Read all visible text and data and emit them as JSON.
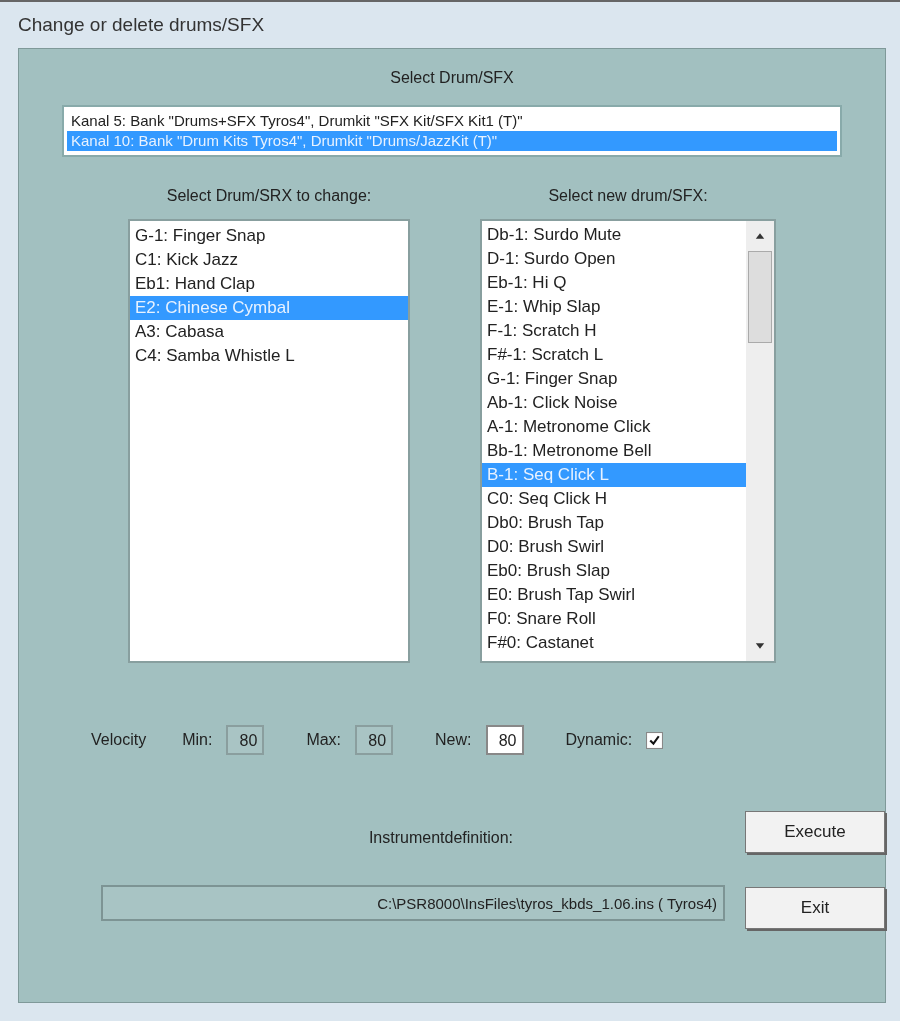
{
  "window": {
    "title": "Change or delete drums/SFX"
  },
  "kit_section": {
    "label": "Select Drum/SFX",
    "items": [
      {
        "text": "Kanal 5: Bank \"Drums+SFX Tyros4\", Drumkit \"SFX Kit/SFX Kit1 (T)\"",
        "selected": false
      },
      {
        "text": "Kanal 10: Bank \"Drum Kits Tyros4\", Drumkit \"Drums/JazzKit (T)\"",
        "selected": true
      }
    ]
  },
  "change_list": {
    "label": "Select Drum/SRX to change:",
    "items": [
      {
        "text": "G-1: Finger Snap",
        "selected": false
      },
      {
        "text": "C1: Kick Jazz",
        "selected": false
      },
      {
        "text": "Eb1: Hand Clap",
        "selected": false
      },
      {
        "text": "E2: Chinese Cymbal",
        "selected": true
      },
      {
        "text": "A3: Cabasa",
        "selected": false
      },
      {
        "text": "C4: Samba Whistle L",
        "selected": false
      }
    ]
  },
  "new_list": {
    "label": "Select new drum/SFX:",
    "items": [
      {
        "text": "Db-1: Surdo Mute",
        "selected": false
      },
      {
        "text": "D-1: Surdo Open",
        "selected": false
      },
      {
        "text": "Eb-1: Hi Q",
        "selected": false
      },
      {
        "text": "E-1: Whip Slap",
        "selected": false
      },
      {
        "text": "F-1: Scratch H",
        "selected": false
      },
      {
        "text": "F#-1: Scratch L",
        "selected": false
      },
      {
        "text": "G-1: Finger Snap",
        "selected": false
      },
      {
        "text": "Ab-1: Click Noise",
        "selected": false
      },
      {
        "text": "A-1: Metronome Click",
        "selected": false
      },
      {
        "text": "Bb-1: Metronome Bell",
        "selected": false
      },
      {
        "text": "B-1: Seq Click L",
        "selected": true
      },
      {
        "text": "C0: Seq Click H",
        "selected": false
      },
      {
        "text": "Db0: Brush Tap",
        "selected": false
      },
      {
        "text": "D0: Brush Swirl",
        "selected": false
      },
      {
        "text": "Eb0: Brush Slap",
        "selected": false
      },
      {
        "text": "E0: Brush Tap Swirl",
        "selected": false
      },
      {
        "text": "F0: Snare Roll",
        "selected": false
      },
      {
        "text": "F#0: Castanet",
        "selected": false
      }
    ]
  },
  "velocity": {
    "label": "Velocity",
    "min_label": "Min:",
    "min": "80",
    "max_label": "Max:",
    "max": "80",
    "new_label": "New:",
    "new": "80",
    "dynamic_label": "Dynamic:",
    "dynamic_checked": true
  },
  "instrument": {
    "label": "Instrumentdefinition:",
    "path": "C:\\PSR8000\\InsFiles\\tyros_kbds_1.06.ins ( Tyros4)"
  },
  "buttons": {
    "execute": "Execute",
    "exit": "Exit"
  }
}
